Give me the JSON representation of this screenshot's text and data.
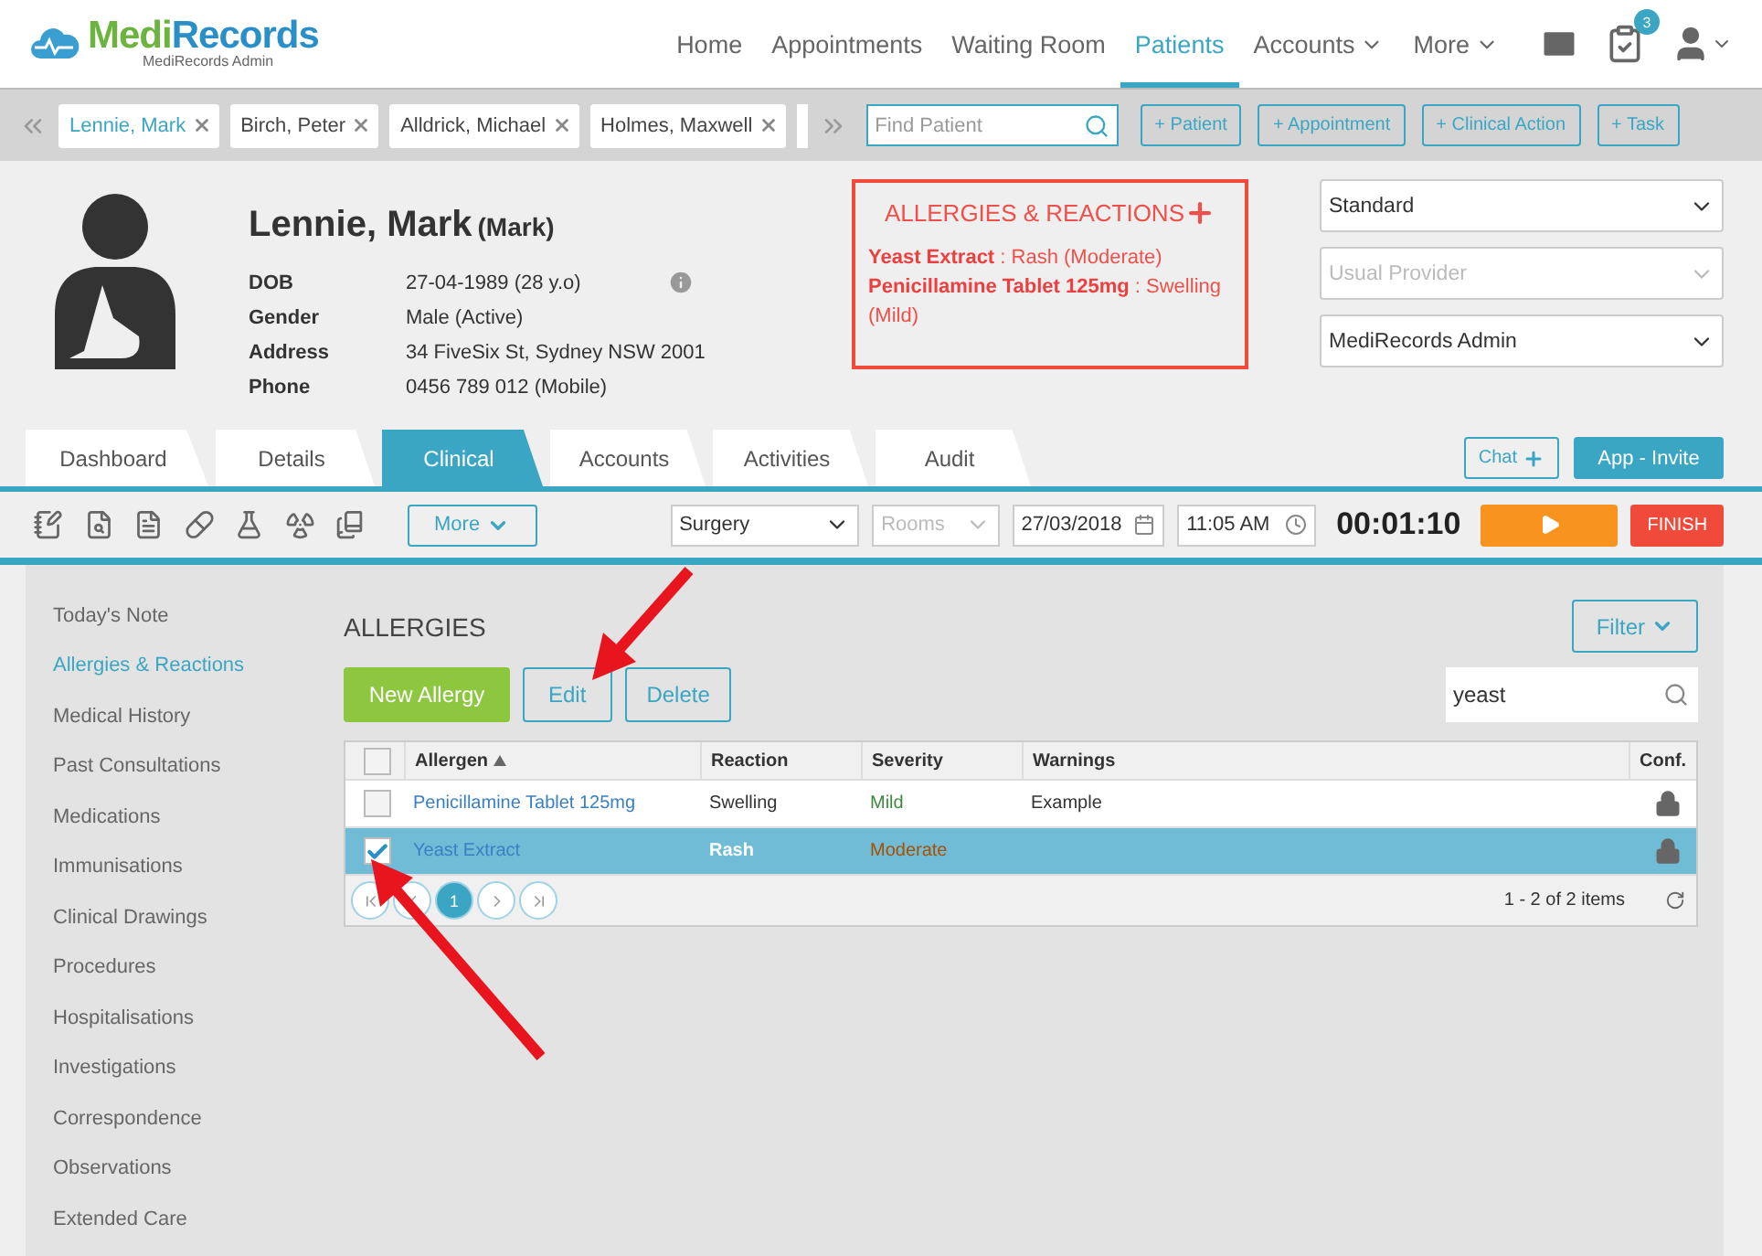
{
  "brand": {
    "first": "Medi",
    "second": "Records",
    "subtitle": "MediRecords Admin"
  },
  "nav": [
    {
      "label": "Home",
      "selected": false,
      "dropdown": false
    },
    {
      "label": "Appointments",
      "selected": false,
      "dropdown": false
    },
    {
      "label": "Waiting Room",
      "selected": false,
      "dropdown": false
    },
    {
      "label": "Patients",
      "selected": true,
      "dropdown": false
    },
    {
      "label": "Accounts",
      "selected": false,
      "dropdown": true
    },
    {
      "label": "More",
      "selected": false,
      "dropdown": true
    }
  ],
  "task_badge": "3",
  "patient_tabs": [
    {
      "name": "Lennie, Mark",
      "selected": true
    },
    {
      "name": "Birch, Peter",
      "selected": false
    },
    {
      "name": "Alldrick, Michael",
      "selected": false
    },
    {
      "name": "Holmes, Maxwell",
      "selected": false
    }
  ],
  "find_patient": {
    "placeholder": "Find Patient"
  },
  "quick_actions": [
    "+ Patient",
    "+ Appointment",
    "+ Clinical Action",
    "+ Task"
  ],
  "patient": {
    "name": "Lennie, Mark",
    "preferred": "(Mark)",
    "fields": [
      {
        "label": "DOB",
        "value": "27-04-1989 (28 y.o)"
      },
      {
        "label": "Gender",
        "value": "Male (Active)"
      },
      {
        "label": "Address",
        "value": "34 FiveSix St, Sydney NSW 2001"
      },
      {
        "label": "Phone",
        "value": "0456 789 012 (Mobile)"
      }
    ]
  },
  "allergy_summary": {
    "title": "ALLERGIES & REACTIONS",
    "items": [
      "**Yeast Extract** : Rash (Moderate)",
      "**Penicillamine Tablet 125mg** : Swelling (Mild)"
    ]
  },
  "selects": [
    {
      "value": "Standard"
    },
    {
      "placeholder": "Usual Provider"
    },
    {
      "value": "MediRecords Admin"
    }
  ],
  "tabs": [
    {
      "label": "Dashboard",
      "selected": false
    },
    {
      "label": "Details",
      "selected": false
    },
    {
      "label": "Clinical",
      "selected": true
    },
    {
      "label": "Accounts",
      "selected": false
    },
    {
      "label": "Activities",
      "selected": false
    },
    {
      "label": "Audit",
      "selected": false
    }
  ],
  "chat_button": "Chat",
  "invite_button": "App - Invite",
  "toolbar": {
    "more": "More",
    "location": "Surgery",
    "rooms_placeholder": "Rooms",
    "date": "27/03/2018",
    "time": "11:05 AM",
    "timer": "00:01:10",
    "finish": "FINISH"
  },
  "sidebar": [
    {
      "label": "Today's Note",
      "selected": false
    },
    {
      "label": "Allergies & Reactions",
      "selected": true
    },
    {
      "label": "Medical History",
      "selected": false
    },
    {
      "label": "Past Consultations",
      "selected": false
    },
    {
      "label": "Medications",
      "selected": false
    },
    {
      "label": "Immunisations",
      "selected": false
    },
    {
      "label": "Clinical Drawings",
      "selected": false
    },
    {
      "label": "Procedures",
      "selected": false
    },
    {
      "label": "Hospitalisations",
      "selected": false
    },
    {
      "label": "Investigations",
      "selected": false
    },
    {
      "label": "Correspondence",
      "selected": false
    },
    {
      "label": "Observations",
      "selected": false
    },
    {
      "label": "Extended Care",
      "selected": false
    }
  ],
  "section": {
    "title": "ALLERGIES",
    "new_button": "New Allergy",
    "edit_button": "Edit",
    "delete_button": "Delete",
    "filter_button": "Filter",
    "search_value": "yeast"
  },
  "table": {
    "all_checked": false,
    "columns": [
      {
        "label": "Allergen",
        "sorted": true
      },
      {
        "label": "Reaction",
        "sorted": false
      },
      {
        "label": "Severity",
        "sorted": false
      },
      {
        "label": "Warnings",
        "sorted": false
      },
      {
        "label": "Conf.",
        "sorted": false
      }
    ],
    "rows": [
      {
        "allergen": "Penicillamine Tablet 125mg",
        "reaction": "Swelling",
        "severity": "Mild",
        "color": "#3c8a3c",
        "warnings": "Example",
        "checked": false,
        "selected": false,
        "confidential": true
      },
      {
        "allergen": "Yeast Extract",
        "reaction": "Rash",
        "severity": "Moderate",
        "color": "#a84f00",
        "warnings": "",
        "checked": true,
        "selected": true,
        "confidential": true
      }
    ]
  },
  "pager": {
    "page": "1",
    "summary": "1 - 2 of 2 items"
  }
}
